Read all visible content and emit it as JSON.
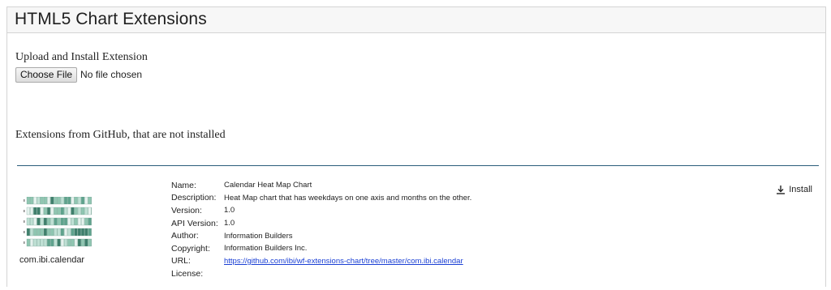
{
  "header": {
    "title": "HTML5 Chart Extensions"
  },
  "upload": {
    "label": "Upload and Install Extension",
    "choose_button": "Choose File",
    "no_file_text": "No file chosen"
  },
  "github": {
    "label": "Extensions from GitHub, that are not installed"
  },
  "extension": {
    "icon": "calendar-heatmap-icon",
    "id_label": "com.ibi.calendar",
    "install_label": "Install",
    "install_icon": "download-icon",
    "fields": {
      "name": {
        "key": "Name:",
        "value": "Calendar Heat Map Chart"
      },
      "description": {
        "key": "Description:",
        "value": "Heat Map chart that has weekdays on one axis and months on the other."
      },
      "version": {
        "key": "Version:",
        "value": "1.0"
      },
      "api_version": {
        "key": "API Version:",
        "value": "1.0"
      },
      "author": {
        "key": "Author:",
        "value": "Information Builders"
      },
      "copyright": {
        "key": "Copyright:",
        "value": "Information Builders Inc."
      },
      "url": {
        "key": "URL:",
        "value": "https://github.com/ibi/wf-extensions-chart/tree/master/com.ibi.calendar"
      },
      "license": {
        "key": "License:",
        "value": ""
      }
    }
  },
  "colors": {
    "divider": "#2a5d7a",
    "link": "#1a3fd4",
    "heat_light": "#cfe7df",
    "heat_dark": "#3f7f6c"
  }
}
